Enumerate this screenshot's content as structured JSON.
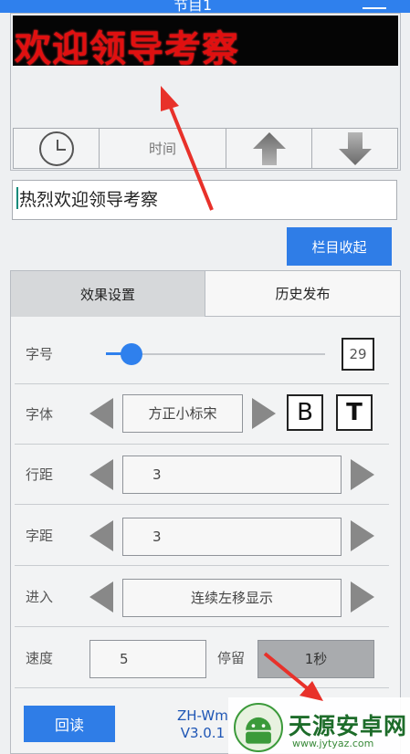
{
  "app": {
    "title": "节目1"
  },
  "led_preview": {
    "text": "欢迎领导考察",
    "text_color": "#e01010",
    "background": "#050505"
  },
  "led_toolbar": {
    "clock_icon": "clock-icon",
    "time_label": "时间",
    "up_icon": "arrow-up-icon",
    "down_icon": "arrow-down-icon"
  },
  "text_input": {
    "value": "热烈欢迎领导考察"
  },
  "collapse_button": {
    "label": "栏目收起"
  },
  "tabs": [
    {
      "label": "效果设置",
      "active": true
    },
    {
      "label": "历史发布",
      "active": false
    }
  ],
  "settings": {
    "font_size": {
      "label": "字号",
      "value": "29"
    },
    "font_face": {
      "label": "字体",
      "value": "方正小标宋",
      "bold_label": "B",
      "text_label": "T"
    },
    "line_spacing": {
      "label": "行距",
      "value": "3"
    },
    "char_spacing": {
      "label": "字距",
      "value": "3"
    },
    "enter": {
      "label": "进入",
      "value": "连续左移显示"
    },
    "speed": {
      "label": "速度",
      "value": "5"
    },
    "stay": {
      "label": "停留",
      "value": "1秒"
    }
  },
  "footer": {
    "readback_label": "回读",
    "version_line1": "ZH-Wm",
    "version_line2": "V3.0.1"
  },
  "watermark": {
    "name": "天源安卓网",
    "url": "www.jytyaz.com"
  },
  "colors": {
    "accent": "#2f80ed",
    "annotation": "#e8312a"
  }
}
